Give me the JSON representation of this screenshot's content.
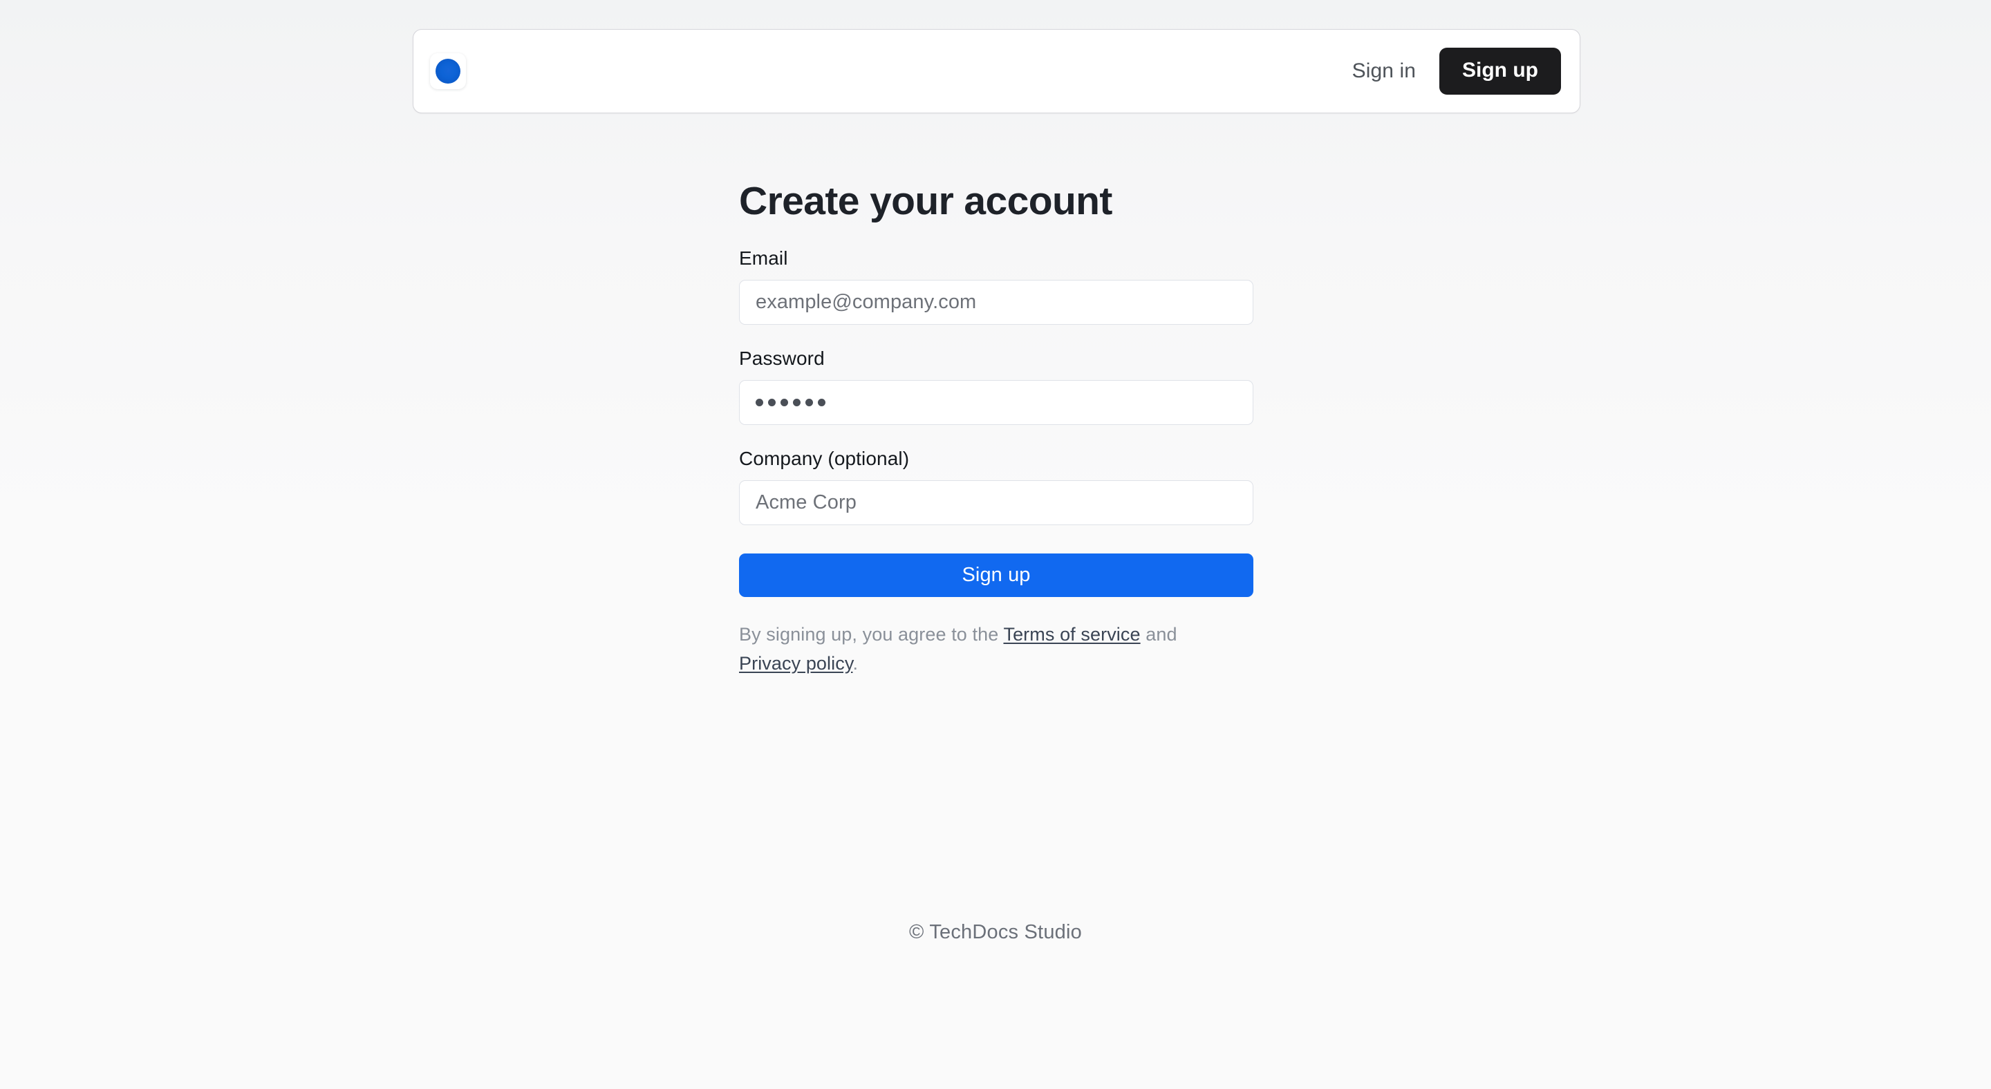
{
  "header": {
    "logo_icon": "blue-circle-logo-icon",
    "nav": {
      "signin_label": "Sign in",
      "signup_label": "Sign up"
    }
  },
  "main": {
    "title": "Create your account",
    "fields": [
      {
        "label": "Email",
        "placeholder": "example@company.com",
        "value": ""
      },
      {
        "label": "Password",
        "placeholder": "",
        "value": "••••••",
        "masked_char_count": 6
      },
      {
        "label": "Company (optional)",
        "placeholder": "Acme Corp",
        "value": ""
      }
    ],
    "submit_label": "Sign up",
    "legal": {
      "prefix": "By signing up, you agree to the ",
      "terms_link": "Terms of service",
      "conjunction": " and ",
      "privacy_link": "Privacy policy",
      "suffix": "."
    }
  },
  "footer": {
    "copyright": "© TechDocs Studio"
  },
  "colors": {
    "brand_blue": "#0d63d6",
    "primary_button": "#1169f0",
    "dark_button": "#1c1c1e",
    "page_background": "#fafafa",
    "border": "#dfe2e8",
    "muted_text": "#8a9099"
  }
}
